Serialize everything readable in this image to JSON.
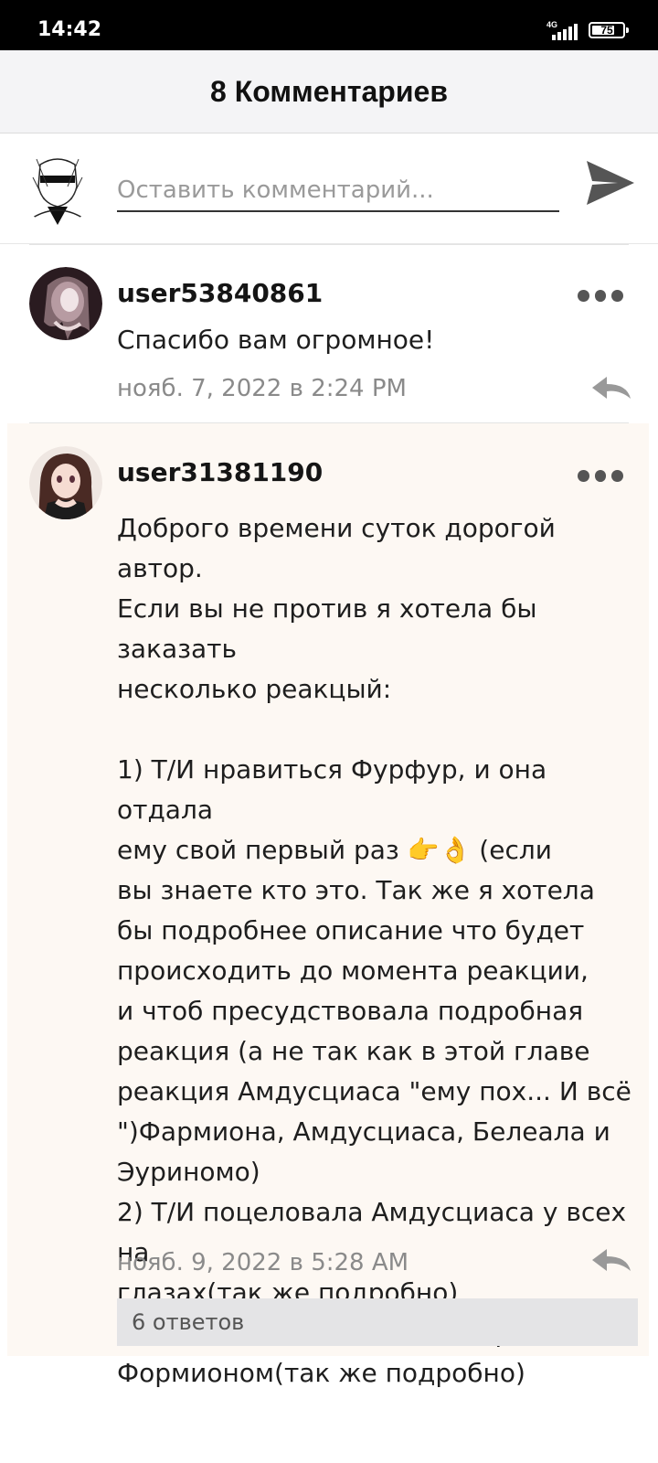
{
  "status_bar": {
    "time": "14:42",
    "network": "4G",
    "battery": "75",
    "battery_level_percent": 75
  },
  "header": {
    "title": "8 Комментариев"
  },
  "composer": {
    "placeholder": "Оставить комментарий..."
  },
  "comments": [
    {
      "username": "user53840861",
      "text": "Спасибо вам огромное!",
      "timestamp": "нояб. 7, 2022 в 2:24 PM"
    },
    {
      "username": "user31381190",
      "text": "Доброго времени суток дорогой автор.\nЕсли вы не против я хотела бы заказать\nнесколько реакцый:\n\n1) Т/И нравиться Фурфур, и она отдала\nему свой первый раз 👉👌 (если\nвы знаете кто это. Так же я хотела\nбы подробнее описание что будет\nпроисходить до момента реакции,\nи чтоб пресудствовала подробная\nреакция (а не так как в этой главе\nреакция Амдусциаса \"ему пох... И всё\n\")Фармиона, Амдусциаса, Белеала и\nЭуриномо)\n2) Т/И поцеловала Амдусциаса у всех на\nглазах(так же подробно)\n3) Т/И по пьяни начала заигрывать с\nФормионом(так же подробно)",
      "timestamp": "нояб. 9, 2022 в 5:28 AM",
      "replies_label": "6 ответов"
    }
  ],
  "colors": {
    "header_bg": "#f4f4f6",
    "highlight_bg": "#fdf8f3",
    "timestamp": "#8a8a8a",
    "replies_bg": "#e4e4e6"
  },
  "icons": [
    "send-icon",
    "more-icon",
    "reply-icon",
    "signal-icon",
    "battery-icon"
  ]
}
